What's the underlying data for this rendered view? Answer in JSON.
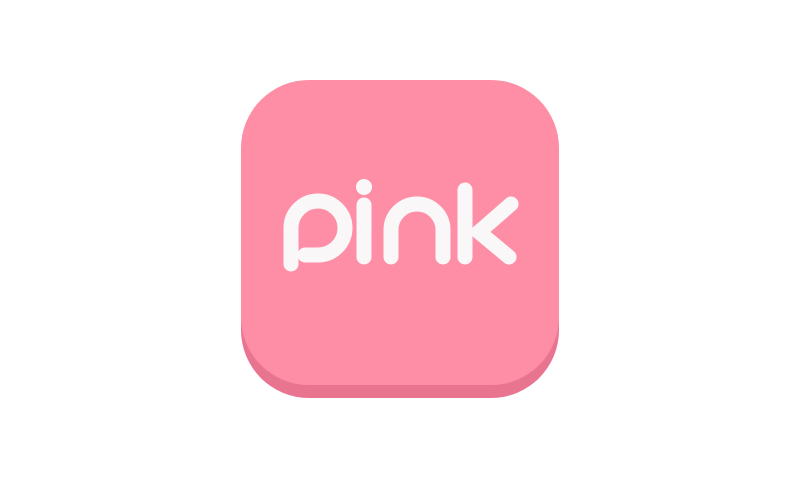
{
  "icon": {
    "wordmark": "pink",
    "face_color": "#fe8ea6",
    "base_color": "#e9748f",
    "text_color": "#faf7f8"
  }
}
